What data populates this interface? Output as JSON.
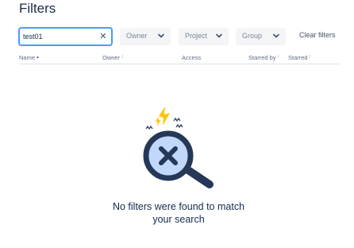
{
  "page": {
    "title": "Filters"
  },
  "filters": {
    "search_value": "test01",
    "clear_icon": "close-icon",
    "owner_label": "Owner",
    "project_label": "Project",
    "group_label": "Group",
    "clear_filters_label": "Clear filters"
  },
  "table": {
    "columns": {
      "name": "Name",
      "owner": "Owner",
      "access": "Access",
      "starred_by": "Starred by",
      "starred": "Starred"
    },
    "sort_ascending_icon": "sort-ascending-icon",
    "sortable_icon": "sortable-icon"
  },
  "empty_state": {
    "illustration": "magnifier-no-results-icon",
    "message_line1": "No filters were found to match",
    "message_line2": "your search"
  },
  "colors": {
    "accent": "#4c9aff",
    "text": "#172b4d",
    "muted": "#7a869a",
    "magnifier": "#253858",
    "lens": "#c1d8fb",
    "spark": "#ffc400"
  }
}
